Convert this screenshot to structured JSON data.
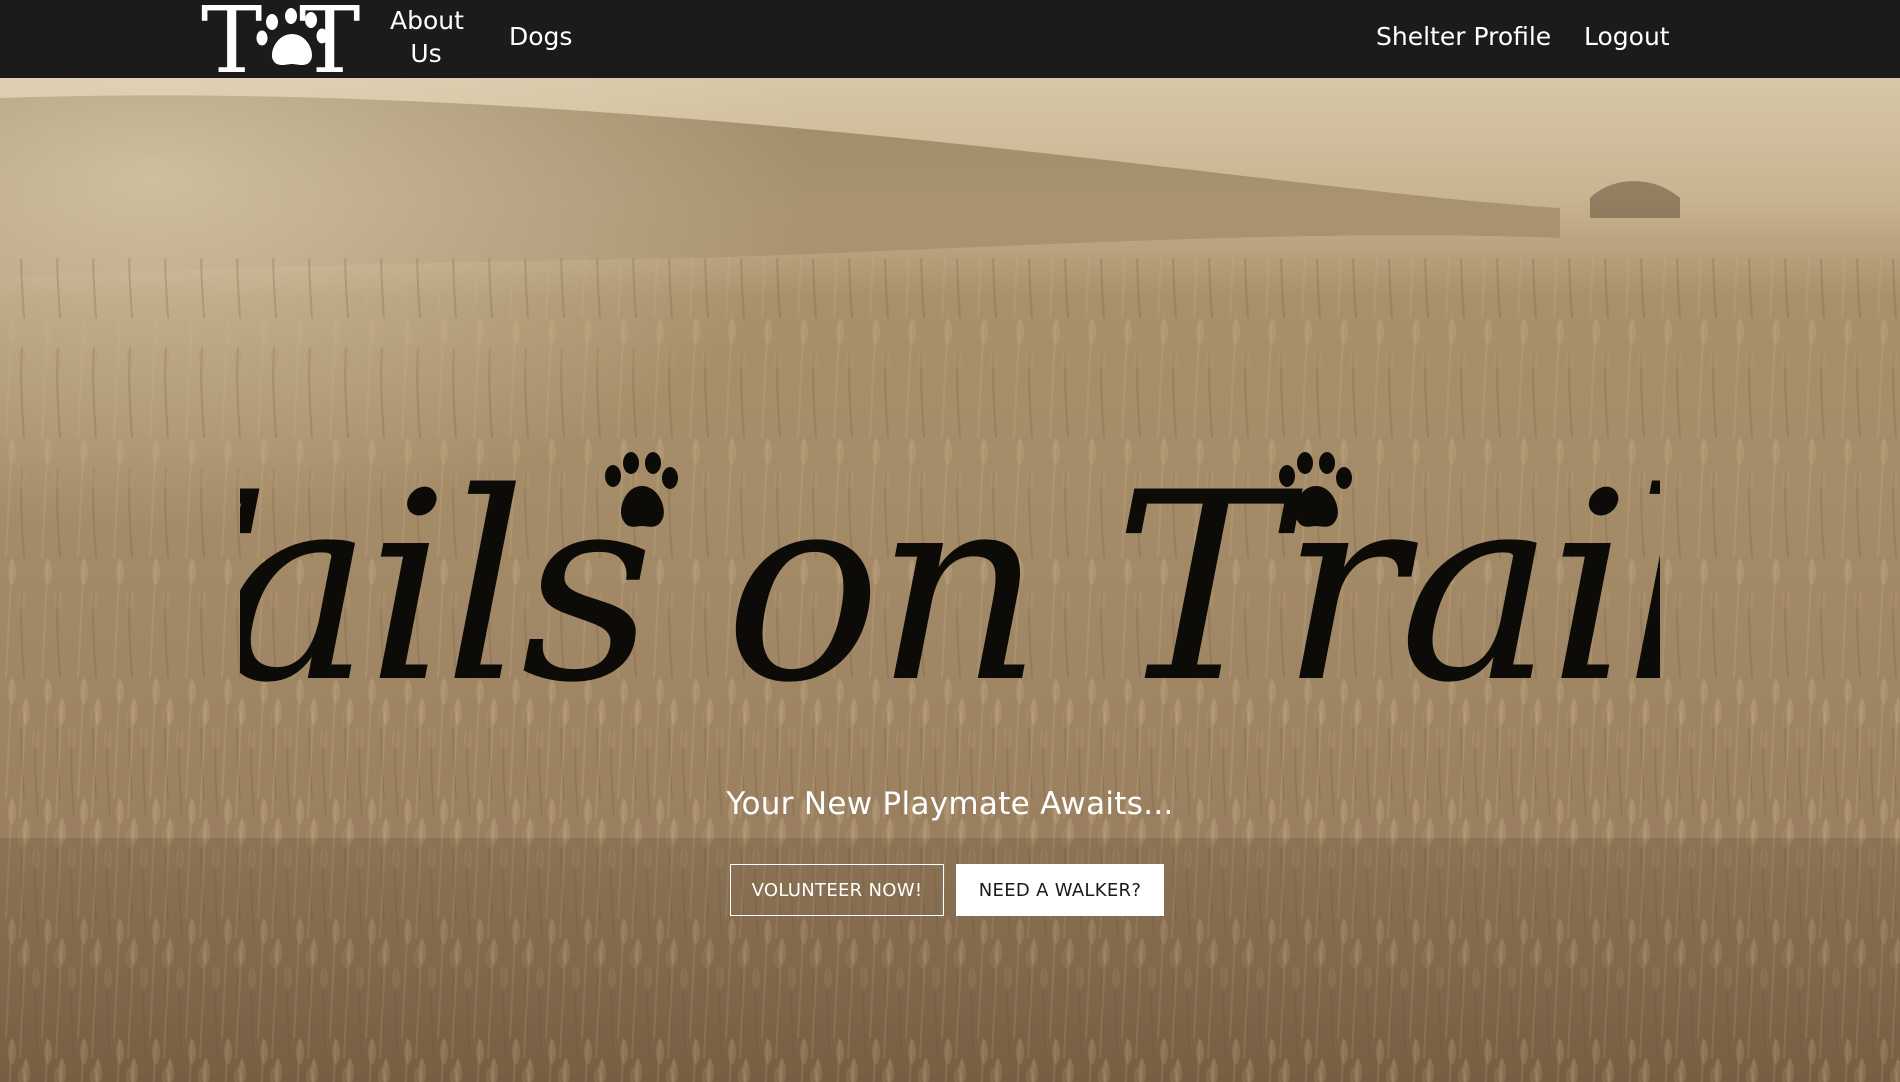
{
  "nav": {
    "logo_text": "TT",
    "about_label": "About Us",
    "dogs_label": "Dogs",
    "shelter_profile_label": "Shelter Profile",
    "logout_label": "Logout"
  },
  "hero": {
    "title": "Tails on Trails",
    "tagline": "Your New Playmate Awaits...",
    "volunteer_button": "VOLUNTEER NOW!",
    "walker_button": "NEED A WALKER?",
    "background": "wheat-field-photo"
  },
  "colors": {
    "navbar": "#1c1b1c",
    "nav_text": "#ffffff",
    "title_ink": "#0d0b08",
    "button_fill": "#ffffff",
    "button_text": "#1c1b1c"
  }
}
